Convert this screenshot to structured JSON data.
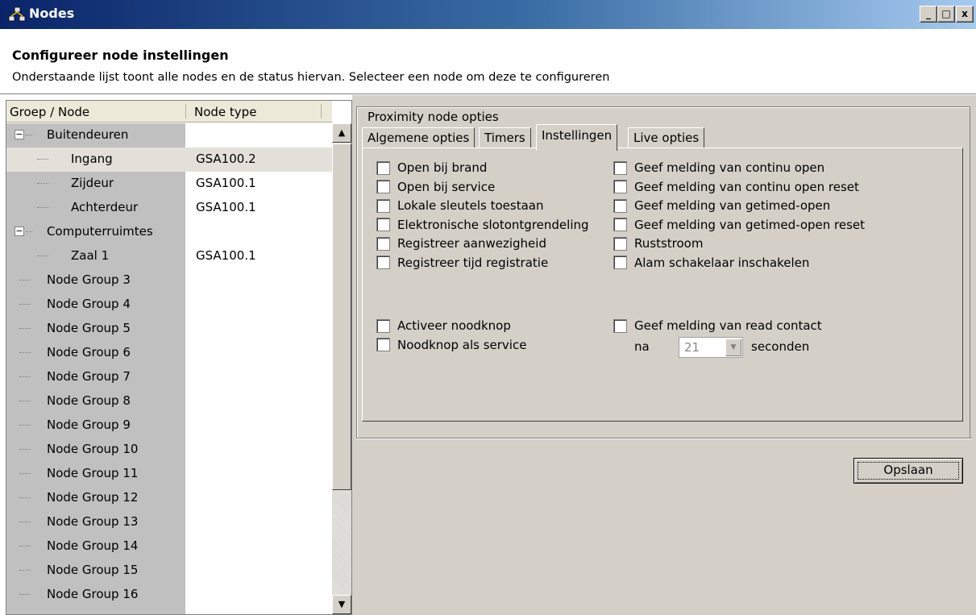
{
  "window": {
    "title": "Nodes",
    "controls": [
      "_",
      "□",
      "x"
    ]
  },
  "header": {
    "title": "Configureer node instellingen",
    "subtitle": "Onderstaande lijst toont alle nodes en de status hiervan. Selecteer een node om deze te configureren"
  },
  "tree": {
    "columns": [
      "Groep / Node",
      "Node type"
    ],
    "rows": [
      {
        "label": "Buitendeuren",
        "type": "",
        "level": 0,
        "expander": "−"
      },
      {
        "label": "Ingang",
        "type": "GSA100.2",
        "level": 1,
        "selected": true
      },
      {
        "label": "Zijdeur",
        "type": "GSA100.1",
        "level": 1
      },
      {
        "label": "Achterdeur",
        "type": "GSA100.1",
        "level": 1
      },
      {
        "label": "Computerruimtes",
        "type": "",
        "level": 0,
        "expander": "−"
      },
      {
        "label": "Zaal 1",
        "type": "GSA100.1",
        "level": 1
      },
      {
        "label": "Node Group 3",
        "type": "",
        "level": 0
      },
      {
        "label": "Node Group 4",
        "type": "",
        "level": 0
      },
      {
        "label": "Node Group 5",
        "type": "",
        "level": 0
      },
      {
        "label": "Node Group 6",
        "type": "",
        "level": 0
      },
      {
        "label": "Node Group 7",
        "type": "",
        "level": 0
      },
      {
        "label": "Node Group 8",
        "type": "",
        "level": 0
      },
      {
        "label": "Node Group 9",
        "type": "",
        "level": 0
      },
      {
        "label": "Node Group 10",
        "type": "",
        "level": 0
      },
      {
        "label": "Node Group 11",
        "type": "",
        "level": 0
      },
      {
        "label": "Node Group 12",
        "type": "",
        "level": 0
      },
      {
        "label": "Node Group 13",
        "type": "",
        "level": 0
      },
      {
        "label": "Node Group 14",
        "type": "",
        "level": 0
      },
      {
        "label": "Node Group 15",
        "type": "",
        "level": 0
      },
      {
        "label": "Node Group 16",
        "type": "",
        "level": 0
      }
    ]
  },
  "panel": {
    "group_label": "Proximity node opties",
    "tabs": [
      "Algemene opties",
      "Timers",
      "Instellingen",
      "Live opties"
    ],
    "active_tab": "Instellingen",
    "left_options": [
      "Open bij brand",
      "Open bij service",
      "Lokale sleutels toestaan",
      "Elektronische slotontgrendeling",
      "Registreer aanwezigheid",
      "Registreer tijd registratie"
    ],
    "right_options": [
      "Geef melding van continu open",
      "Geef melding van continu open reset",
      "Geef melding van getimed-open",
      "Geef melding van getimed-open reset",
      "Ruststroom",
      "Alam schakelaar inschakelen"
    ],
    "left_options_2": [
      "Activeer noodknop",
      "Noodknop als service"
    ],
    "read_contact": "Geef melding van read contact",
    "delay_prefix": "na",
    "delay_value": "21",
    "delay_suffix": "seconden",
    "save_label": "Opslaan"
  }
}
